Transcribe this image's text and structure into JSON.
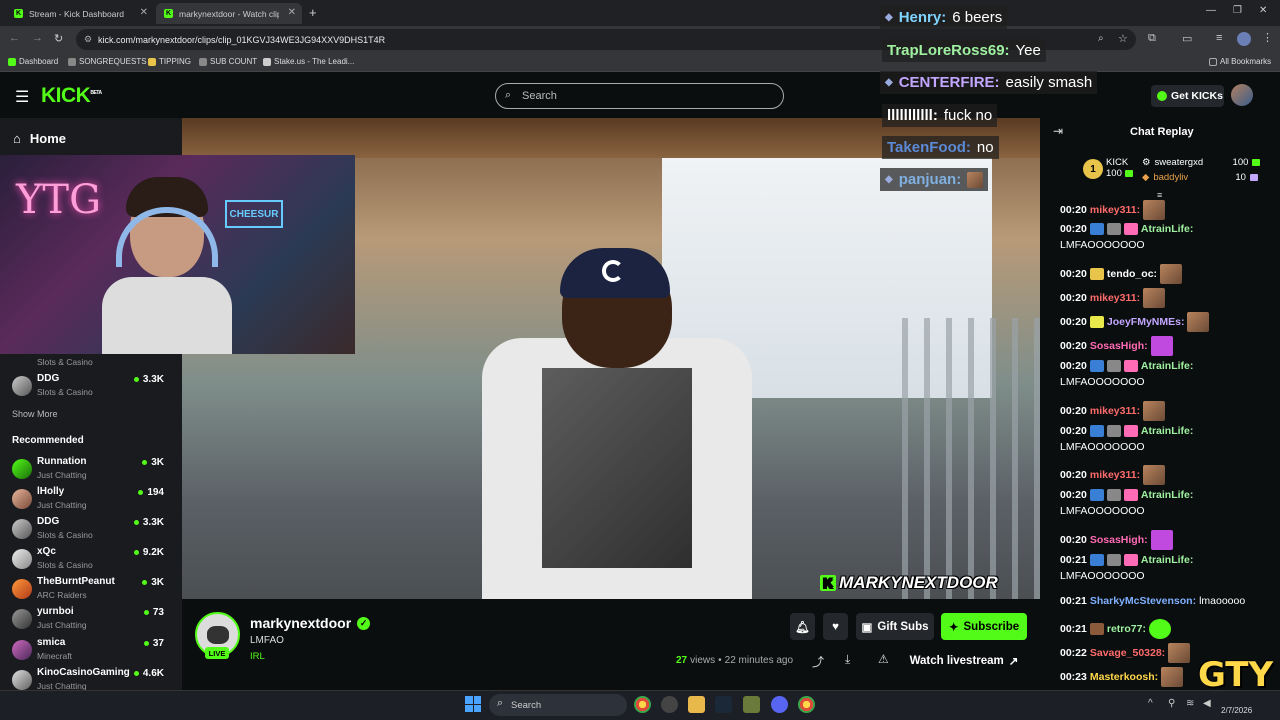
{
  "browser": {
    "tabs": [
      {
        "title": "Stream - Kick Dashboard"
      },
      {
        "title": "markynextdoor - Watch clip"
      }
    ],
    "url": "kick.com/markynextdoor/clips/clip_01KGVJ34WE3JG94XXV9DHS1T4R",
    "bookmarks": [
      "Dashboard",
      "SONGREQUESTS",
      "TIPPING",
      "SUB COUNT",
      "Stake.us - The Leadi...",
      "All Bookmarks"
    ]
  },
  "header": {
    "logo": "KICK",
    "logo_beta": "BETA",
    "search_placeholder": "Search",
    "get_kicks": "Get KICKs"
  },
  "sidebar": {
    "home": "Home",
    "partial_item_sub": "Slots & Casino",
    "following": [
      {
        "name": "DDG",
        "category": "Slots & Casino",
        "viewers": "3.3K"
      }
    ],
    "show_more": "Show More",
    "recommended_title": "Recommended",
    "recommended": [
      {
        "name": "Runnation",
        "category": "Just Chatting",
        "viewers": "3K"
      },
      {
        "name": "lHolly",
        "category": "Just Chatting",
        "viewers": "194"
      },
      {
        "name": "DDG",
        "category": "Slots & Casino",
        "viewers": "3.3K"
      },
      {
        "name": "xQc",
        "category": "Slots & Casino",
        "viewers": "9.2K"
      },
      {
        "name": "TheBurntPeanut",
        "category": "ARC Raiders",
        "viewers": "3K"
      },
      {
        "name": "yurnboi",
        "category": "Just Chatting",
        "viewers": "73"
      },
      {
        "name": "smica",
        "category": "Minecraft",
        "viewers": "37"
      },
      {
        "name": "KinoCasinoGaming",
        "category": "Just Chatting",
        "viewers": "4.6K"
      }
    ]
  },
  "webcam": {
    "sign": "YTG",
    "neon": "CHEESUR"
  },
  "video": {
    "watermark": "MARKYNEXTDOOR",
    "watermark_badge": "K"
  },
  "overlay_chat": [
    {
      "user": "Henry:",
      "message": "6 beers",
      "color": "#7fd4ff"
    },
    {
      "user": "TrapLoreRoss69:",
      "message": "Yee",
      "color": "#9ff0a0"
    },
    {
      "user": "CENTERFIRE:",
      "message": "easily smash",
      "color": "#c2a6ff"
    },
    {
      "user": "lllllllllll:",
      "message": "fuck no",
      "color": "#ffffff"
    },
    {
      "user": "TakenFood:",
      "message": "no",
      "color": "#5b8ad6"
    },
    {
      "user": "panjuan:",
      "message": "",
      "color": "#7fb0e0"
    }
  ],
  "channel": {
    "name": "markynextdoor",
    "title": "LMFAO",
    "category": "IRL",
    "live_badge": "LIVE",
    "views": "27",
    "views_label": "views",
    "time_ago": "22 minutes ago",
    "gift_subs": "Gift Subs",
    "subscribe": "Subscribe",
    "watch_livestream": "Watch livestream"
  },
  "chat": {
    "title": "Chat Replay",
    "leaderboard": {
      "rank": "1",
      "first": {
        "name": "KICK",
        "amount": "100"
      },
      "second": {
        "name": "sweatergxd",
        "amount": "100"
      },
      "third": {
        "name": "baddyliv",
        "amount": "10"
      }
    },
    "messages": [
      {
        "time": "00:20",
        "user": "mikey311:",
        "color": "#ff6b6b",
        "text": "",
        "cont": ""
      },
      {
        "time": "00:20",
        "user": "AtrainLife:",
        "color": "#9ff0a0",
        "text": "",
        "cont": "LMFAOOOOOOO"
      },
      {
        "time": "00:20",
        "user": "tendo_oc:",
        "color": "#ffffff",
        "text": "",
        "cont": ""
      },
      {
        "time": "00:20",
        "user": "mikey311:",
        "color": "#ff6b6b",
        "text": "",
        "cont": ""
      },
      {
        "time": "00:20",
        "user": "JoeyFMyNMEs:",
        "color": "#c2a6ff",
        "text": "",
        "cont": ""
      },
      {
        "time": "00:20",
        "user": "SosasHigh:",
        "color": "#ff6bb5",
        "text": "",
        "cont": ""
      },
      {
        "time": "00:20",
        "user": "AtrainLife:",
        "color": "#9ff0a0",
        "text": "",
        "cont": "LMFAOOOOOOO"
      },
      {
        "time": "00:20",
        "user": "mikey311:",
        "color": "#ff6b6b",
        "text": "",
        "cont": ""
      },
      {
        "time": "00:20",
        "user": "AtrainLife:",
        "color": "#9ff0a0",
        "text": "",
        "cont": "LMFAOOOOOOO"
      },
      {
        "time": "00:20",
        "user": "mikey311:",
        "color": "#ff6b6b",
        "text": "",
        "cont": ""
      },
      {
        "time": "00:20",
        "user": "AtrainLife:",
        "color": "#9ff0a0",
        "text": "",
        "cont": "LMFAOOOOOOO"
      },
      {
        "time": "00:20",
        "user": "SosasHigh:",
        "color": "#ff6bb5",
        "text": "",
        "cont": ""
      },
      {
        "time": "00:21",
        "user": "AtrainLife:",
        "color": "#9ff0a0",
        "text": "",
        "cont": "LMFAOOOOOOO"
      },
      {
        "time": "00:21",
        "user": "SharkyMcStevenson:",
        "color": "#7fb0ff",
        "text": "lmaooooo",
        "cont": ""
      },
      {
        "time": "00:21",
        "user": "retro77:",
        "color": "#9ff0a0",
        "text": "",
        "cont": ""
      },
      {
        "time": "00:22",
        "user": "Savage_50328:",
        "color": "#ff6b6b",
        "text": "",
        "cont": ""
      },
      {
        "time": "00:23",
        "user": "Masterkoosh:",
        "color": "#ffd84a",
        "text": "",
        "cont": ""
      }
    ]
  },
  "taskbar": {
    "search": "Search",
    "date": "2/7/2026",
    "corner_logo": "GTY"
  },
  "colors": {
    "accent": "#53fc18",
    "bg": "#0b0e0f",
    "panel": "#191b1f"
  }
}
